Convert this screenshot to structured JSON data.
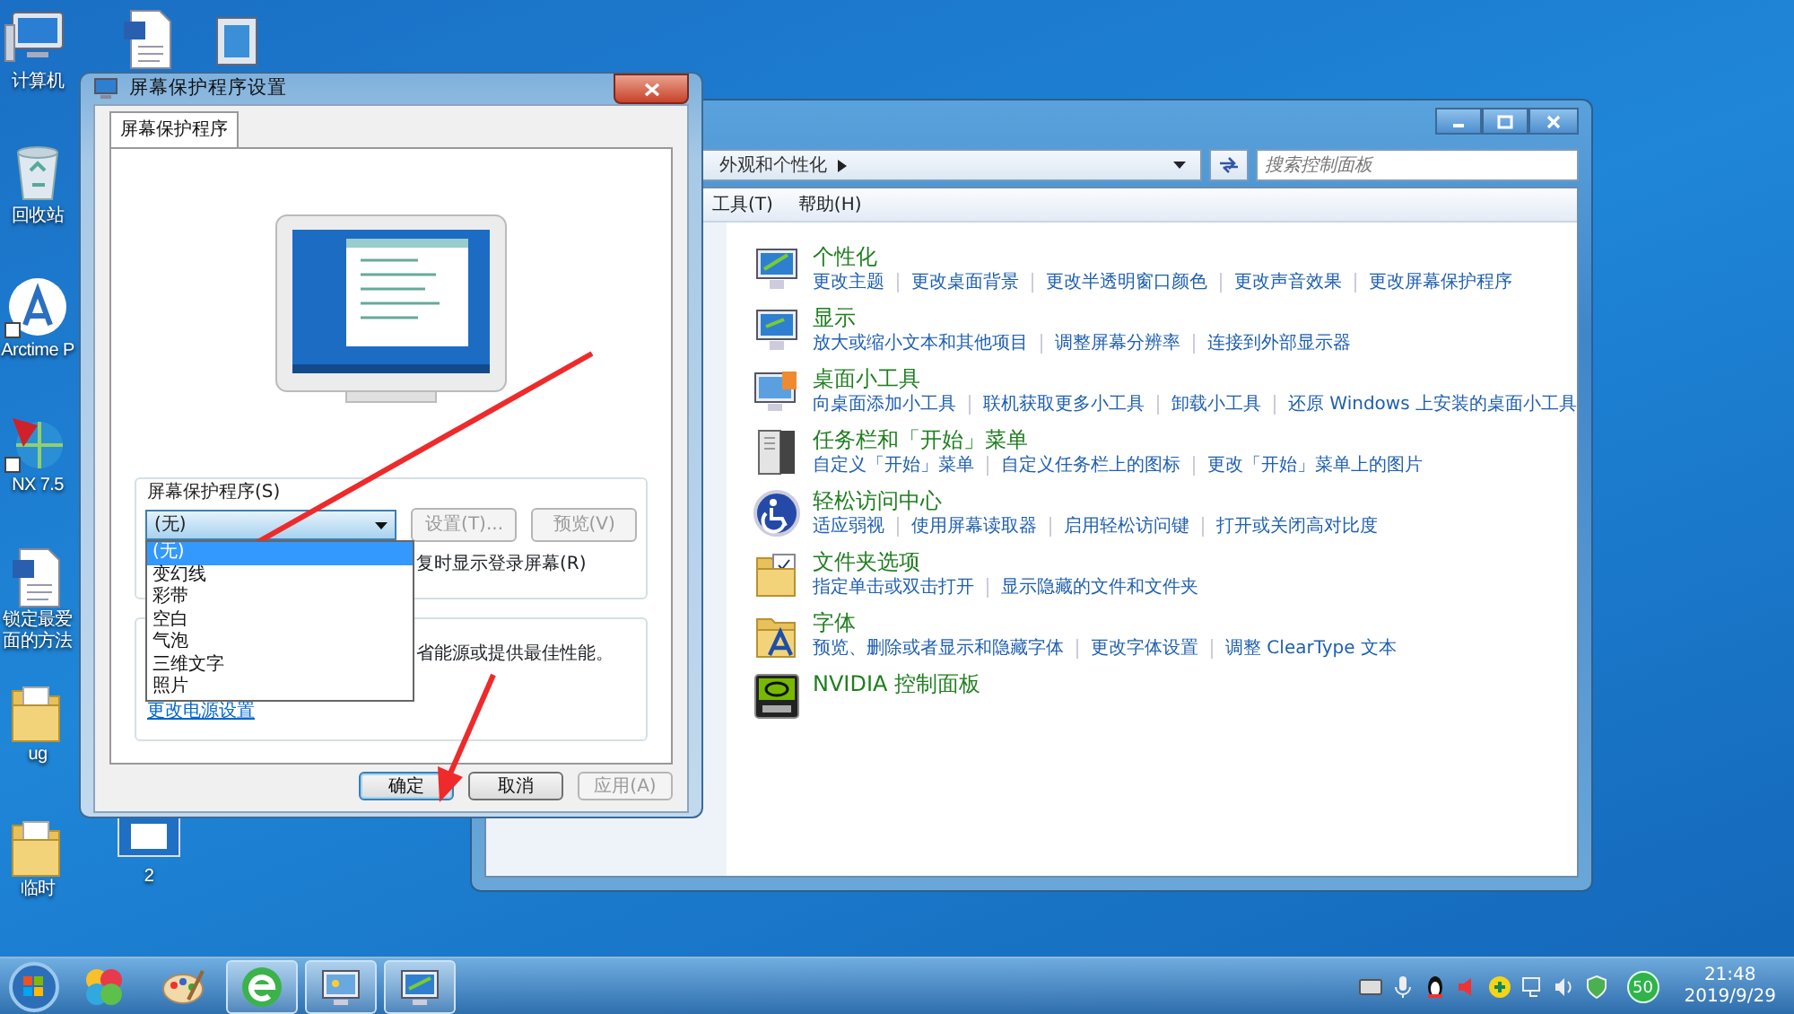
{
  "desktop": {
    "columns": [
      [
        {
          "kind": "computer",
          "label": "计算机"
        },
        {
          "kind": "recycle_bin",
          "label": "回收站"
        },
        {
          "kind": "arctime",
          "label": "Arctime P"
        },
        {
          "kind": "nx",
          "label": "NX 7.5"
        },
        {
          "kind": "document",
          "label": "锁定最爱面的方法"
        },
        {
          "kind": "folder",
          "label": "ug"
        },
        {
          "kind": "folder",
          "label": "临时"
        }
      ],
      [
        {
          "kind": "document"
        },
        {
          "kind": "screenshot",
          "label": "2"
        }
      ],
      [
        {
          "kind": "window_app"
        }
      ]
    ]
  },
  "control_panel": {
    "breadcrumb": "外观和个性化",
    "search": {
      "placeholder": "搜索控制面板"
    },
    "menu": [
      "工具(T)",
      "帮助(H)"
    ],
    "categories": [
      {
        "title": "个性化",
        "links": [
          "更改主题",
          "更改桌面背景",
          "更改半透明窗口颜色",
          "更改声音效果",
          "更改屏幕保护程序"
        ]
      },
      {
        "title": "显示",
        "links": [
          "放大或缩小文本和其他项目",
          "调整屏幕分辨率",
          "连接到外部显示器"
        ]
      },
      {
        "title": "桌面小工具",
        "links": [
          "向桌面添加小工具",
          "联机获取更多小工具",
          "卸载小工具",
          "还原 Windows 上安装的桌面小工具"
        ]
      },
      {
        "title": "任务栏和「开始」菜单",
        "links": [
          "自定义「开始」菜单",
          "自定义任务栏上的图标",
          "更改「开始」菜单上的图片"
        ]
      },
      {
        "title": "轻松访问中心",
        "links": [
          "适应弱视",
          "使用屏幕读取器",
          "启用轻松访问键",
          "打开或关闭高对比度"
        ]
      },
      {
        "title": "文件夹选项",
        "links": [
          "指定单击或双击打开",
          "显示隐藏的文件和文件夹"
        ]
      },
      {
        "title": "字体",
        "links": [
          "预览、删除或者显示和隐藏字体",
          "更改字体设置",
          "调整 ClearType 文本"
        ]
      },
      {
        "title": "NVIDIA 控制面板"
      }
    ]
  },
  "dialog": {
    "title": "屏幕保护程序设置",
    "tabs": [
      {
        "label": "屏幕保护程序",
        "selected": true
      }
    ],
    "saver_group": {
      "label": "屏幕保护程序(S)",
      "dropdown": {
        "value": "(无)",
        "expanded": true,
        "options": [
          {
            "label": "(无)",
            "selected": true
          },
          {
            "label": "变幻线",
            "selected": false
          },
          {
            "label": "彩带",
            "selected": false
          },
          {
            "label": "空白",
            "selected": false
          },
          {
            "label": "气泡",
            "selected": false
          },
          {
            "label": "三维文字",
            "selected": false
          },
          {
            "label": "照片",
            "selected": false
          }
        ]
      },
      "buttons": [
        {
          "label": "设置(T)...",
          "disabled": true
        },
        {
          "label": "预览(V)",
          "disabled": true
        }
      ],
      "resume_text": "复时显示登录屏幕(R)"
    },
    "power_group": {
      "text": "省能源或提供最佳性能。",
      "link": "更改电源设置"
    },
    "buttons": [
      {
        "label": "确定",
        "disabled": false,
        "default": true
      },
      {
        "label": "取消",
        "disabled": false,
        "default": false
      },
      {
        "label": "应用(A)",
        "disabled": true,
        "default": false
      }
    ]
  },
  "taskbar": {
    "apps": [
      {
        "kind": "colorful",
        "active": false
      },
      {
        "kind": "paint",
        "active": false
      },
      {
        "kind": "browser",
        "active": true
      },
      {
        "kind": "control_panel",
        "active": true
      },
      {
        "kind": "display",
        "active": true
      }
    ],
    "tray_badge": "50",
    "time": "21:48",
    "date": "2019/9/29"
  }
}
